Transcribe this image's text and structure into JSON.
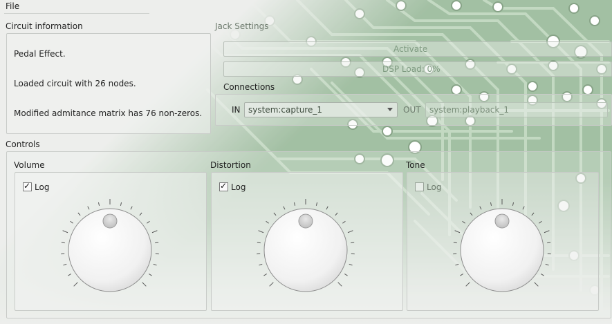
{
  "menu": {
    "file_label": "File"
  },
  "circuit_info": {
    "title": "Circuit information",
    "lines": [
      "Pedal Effect.",
      "Loaded circuit with 26 nodes.",
      "Modified admitance matrix has 76 non-zeros."
    ]
  },
  "jack": {
    "title": "Jack Settings",
    "activate_label": "Activate",
    "dsp_load_label": "DSP Load: 0%",
    "connections_title": "Connections",
    "in_label": "IN",
    "in_value": "system:capture_1",
    "out_label": "OUT",
    "out_value": "system:playback_1"
  },
  "controls": {
    "title": "Controls",
    "knobs": [
      {
        "title": "Volume",
        "log_label": "Log",
        "log_checked": true
      },
      {
        "title": "Distortion",
        "log_label": "Log",
        "log_checked": true
      },
      {
        "title": "Tone",
        "log_label": "Log",
        "log_checked": false
      }
    ]
  },
  "theme": {
    "pcb_green": "#8fb48f",
    "board_light": "#e9ebe8"
  }
}
